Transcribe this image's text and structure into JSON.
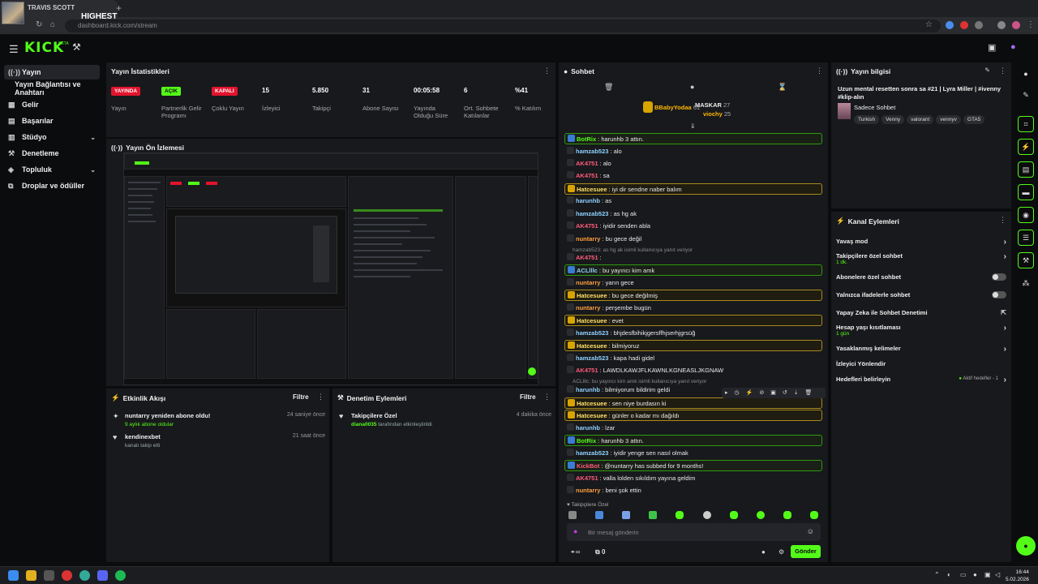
{
  "browser": {
    "tab_title": "TRAVIS SCOTT",
    "overlay_title": "HIGHEST",
    "url": "dashboard.kick.com/stream"
  },
  "kick": {
    "logo": "KICK",
    "logo_beta": "BETA"
  },
  "sidebar": {
    "items": [
      {
        "label": "Yayın",
        "icon": "broadcast-icon"
      },
      {
        "label": "Yayın Bağlantısı ve Anahtarı",
        "icon": "key-icon"
      },
      {
        "label": "Gelir",
        "icon": "revenue-icon"
      },
      {
        "label": "Başarılar",
        "icon": "achievements-icon"
      },
      {
        "label": "Stüdyo",
        "icon": "studio-icon"
      },
      {
        "label": "Denetleme",
        "icon": "moderation-icon"
      },
      {
        "label": "Topluluk",
        "icon": "community-icon"
      },
      {
        "label": "Droplar ve ödüller",
        "icon": "gift-icon"
      }
    ]
  },
  "stats": {
    "title": "Yayın İstatistikleri",
    "items": [
      {
        "value": "YAYINDA",
        "label": "Yayın",
        "badge_color": "#e2132e"
      },
      {
        "value": "AÇIK",
        "label": "Partnerlik Gelir Programı",
        "badge_color": "#53fc18"
      },
      {
        "value": "KAPALI",
        "label": "Çoklu Yayın",
        "badge_color": "#e2132e"
      },
      {
        "value": "15",
        "label": "İzleyici"
      },
      {
        "value": "5.850",
        "label": "Takipçi"
      },
      {
        "value": "31",
        "label": "Abone Sayısı"
      },
      {
        "value": "00:05:58",
        "label": "Yayında Olduğu Süre"
      },
      {
        "value": "6",
        "label": "Ort. Sohbete Katılanlar"
      },
      {
        "value": "%41",
        "label": "% Katılım"
      }
    ]
  },
  "preview": {
    "title": "Yayın Ön İzlemesi"
  },
  "activity": {
    "title": "Etkinlik Akışı",
    "filter": "Filtre",
    "items": [
      {
        "main": "nuntarry yeniden abone oldu!",
        "sub": "9 aylık abone oldular",
        "time": "24 saniye önce"
      },
      {
        "main": "kendinexbet",
        "sub": "kanalı takip etti",
        "time": "21 saat önce"
      }
    ]
  },
  "moderation": {
    "title": "Denetim Eylemleri",
    "filter": "Filtre",
    "items": [
      {
        "main": "Takipçilere Özel",
        "user": "diana0035",
        "sub": "tarafından etkinleştirildi",
        "time": "4 dakika önce"
      }
    ]
  },
  "chat": {
    "title": "Sohbet",
    "top_gifters": [
      {
        "name": "BBabyYodaa",
        "count": "61"
      },
      {
        "name": "MASKAR",
        "count": "27"
      },
      {
        "name": "viochy",
        "count": "25"
      }
    ],
    "messages": [
      {
        "user": "BotRix",
        "text": "harunhb 3 attın.",
        "color": "#53fc18",
        "style": "hl"
      },
      {
        "user": "hamzab523",
        "text": "alo",
        "color": "#8fd2ff"
      },
      {
        "user": "AK4751",
        "text": "alo",
        "color": "#ff5b7a"
      },
      {
        "user": "AK4751",
        "text": "sa",
        "color": "#ff5b7a"
      },
      {
        "user": "Hatcesuee",
        "text": "iyi dir sendne naber balım",
        "color": "#ffe066",
        "style": "hly"
      },
      {
        "user": "harunhb",
        "text": "as",
        "color": "#8fd2ff"
      },
      {
        "user": "hamzab523",
        "text": "as hg ak",
        "color": "#8fd2ff"
      },
      {
        "user": "AK4751",
        "text": "iyidir senden abla",
        "color": "#ff5b7a"
      },
      {
        "user": "nuntarry",
        "text": "bu gece değil",
        "color": "#ff9f40"
      },
      {
        "user": "AK4751",
        "text": "",
        "color": "#ff5b7a"
      },
      {
        "user": "ACLlllc",
        "text": "bu yayıncı kim amk",
        "color": "#8fd2ff",
        "style": "hl"
      },
      {
        "user": "nuntarry",
        "text": "yarın gece",
        "color": "#ff9f40"
      },
      {
        "user": "Hatcesuee",
        "text": "bu gece değilmiş",
        "color": "#ffe066",
        "style": "hly"
      },
      {
        "user": "nuntarry",
        "text": "perşembe bugün",
        "color": "#ff9f40"
      },
      {
        "user": "Hatcesuee",
        "text": "evet",
        "color": "#ffe066",
        "style": "hly"
      },
      {
        "user": "hamzab523",
        "text": "bhjdesfbihikjgersffhjserhjgrsüğ",
        "color": "#8fd2ff"
      },
      {
        "user": "Hatcesuee",
        "text": "bilmiyoruz",
        "color": "#ffe066",
        "style": "hly"
      },
      {
        "user": "hamzab523",
        "text": "kapa hadi gidel",
        "color": "#8fd2ff"
      },
      {
        "user": "AK4751",
        "text": "LAWDLKAWJFLKAWNLKGNEASLJKGNAW",
        "color": "#ff5b7a"
      },
      {
        "user": "harunhb",
        "text": "bilmiyorum bildirim geldi",
        "color": "#8fd2ff"
      },
      {
        "user": "Hatcesuee",
        "text": "sen niye burdasın ki",
        "color": "#ffe066",
        "style": "hly"
      },
      {
        "user": "Hatcesuee",
        "text": "günler o kadar mı dağıldı",
        "color": "#ffe066",
        "style": "hly"
      },
      {
        "user": "harunhb",
        "text": "lzar",
        "color": "#8fd2ff"
      },
      {
        "user": "BotRix",
        "text": "harunhb 3 attın.",
        "color": "#53fc18",
        "style": "hl"
      },
      {
        "user": "hamzab523",
        "text": "iyidir yenge sen nasıl olmak",
        "color": "#8fd2ff"
      },
      {
        "user": "KickBot",
        "text": "@nuntarry has subbed for 9 months!",
        "color": "#ff5b7a",
        "style": "hl"
      },
      {
        "user": "AK4751",
        "text": "valla lolden sıkıldım yayına geldim",
        "color": "#ff5b7a"
      },
      {
        "user": "nuntarry",
        "text": "beni şok ettin",
        "color": "#ff9f40"
      }
    ],
    "reply_note_1": "hamzab523: as hg ak isimli kullanıcıya yanıt veriyor",
    "reply_note_2": "ACLlllc: bu yayıncı kim amk isimli kullanıcıya yanıt veriyor",
    "followers_only": "Takipçilere Özel",
    "input_placeholder": "Bir mesaj gönderin",
    "send_label": "Gönder",
    "footer_count": "0"
  },
  "stream_info": {
    "title": "Yayın bilgisi",
    "stream_title": "Uzun mental resetten sonra sa #21 | Lyra Miller | #ivenny #klip-alın",
    "category": "Sadece Sohbet",
    "tags": [
      "Turkish",
      "Venny",
      "valorant",
      "vennyv",
      "GTA5"
    ]
  },
  "channel_actions": {
    "title": "Kanal Eylemleri",
    "items": [
      {
        "label": "Yavaş mod",
        "sub": "",
        "control": "arrow"
      },
      {
        "label": "Takipçilere özel sohbet",
        "sub": "1 dk.",
        "control": "arrow"
      },
      {
        "label": "Abonelere özel sohbet",
        "sub": "",
        "control": "toggle"
      },
      {
        "label": "Yalnızca ifadelerle sohbet",
        "sub": "",
        "control": "toggle"
      },
      {
        "label": "Yapay Zeka ile Sohbet Denetimi",
        "sub": "",
        "control": "external"
      },
      {
        "label": "Hesap yaşı kısıtlaması",
        "sub": "1 gün",
        "control": "arrow"
      },
      {
        "label": "Yasaklanmış kelimeler",
        "sub": "",
        "control": "arrow"
      },
      {
        "label": "İzleyici Yönlendir",
        "sub": "",
        "control": "none"
      },
      {
        "label": "Hedefleri belirleyin",
        "sub": "",
        "control": "goal",
        "goal_text": "Aktif hedefler - 1"
      }
    ]
  },
  "taskbar": {
    "time": "16:44",
    "date": "5.02.2026"
  }
}
